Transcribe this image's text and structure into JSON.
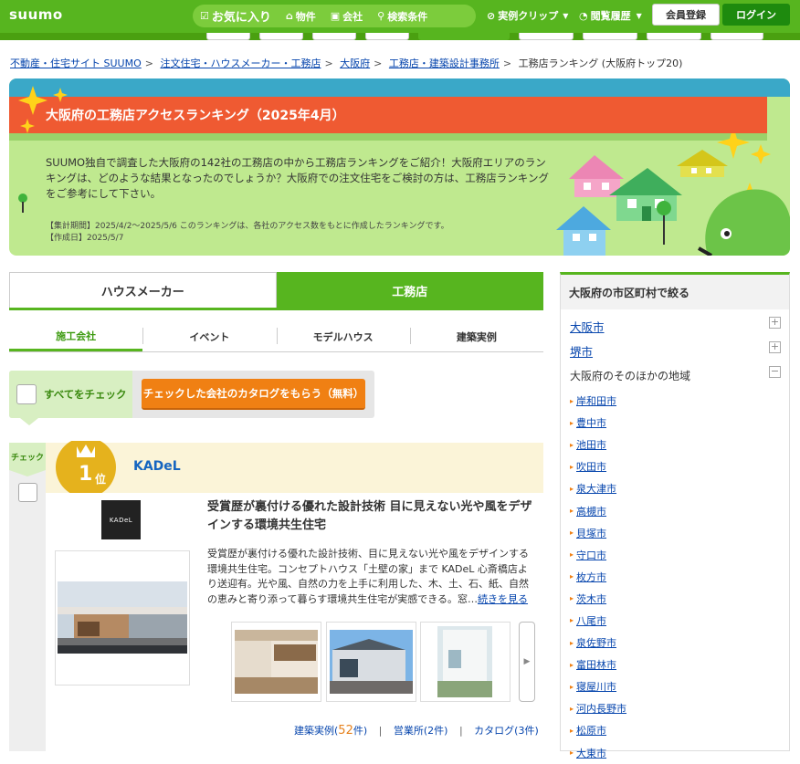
{
  "header": {
    "logo": "suumo",
    "nav": {
      "favorites": "お気に入り",
      "property": "物件",
      "company": "会社",
      "search": "検索条件"
    },
    "clip": "実例クリップ",
    "history": "閲覧履歴",
    "member": "会員登録",
    "login": "ログイン"
  },
  "breadcrumb": {
    "items": [
      "不動産・住宅サイト SUUMO",
      "注文住宅・ハウスメーカー・工務店",
      "大阪府",
      "工務店・建築設計事務所"
    ],
    "current": "工務店ランキング (大阪府トップ20)"
  },
  "hero": {
    "title": "大阪府の工務店アクセスランキング（2025年4月）",
    "description": "SUUMO独自で調査した大阪府の142社の工務店の中から工務店ランキングをご紹介！大阪府エリアのランキングは、どのような結果となったのでしょうか？大阪府での注文住宅をご検討の方は、工務店ランキングをご参考にして下さい。",
    "period": "【集計期間】2025/4/2～2025/5/6 このランキングは、各社のアクセス数をもとに作成したランキングです。",
    "created": "【作成日】2025/5/7"
  },
  "tabs": {
    "main": [
      "ハウスメーカー",
      "工務店"
    ],
    "sub": [
      "施工会社",
      "イベント",
      "モデルハウス",
      "建築実例"
    ]
  },
  "checkbar": {
    "check_all": "すべてをチェック",
    "catalog_button": "チェックした会社のカタログをもらう（無料）"
  },
  "ranking": {
    "check_label": "チェック",
    "rank_number": "1",
    "rank_suffix": "位",
    "company": "KADeL",
    "logo_text": "KADeL",
    "heading": "受賞歴が裏付ける優れた設計技術 目に見えない光や風をデザインする環境共生住宅",
    "description": "受賞歴が裏付ける優れた設計技術、目に見えない光や風をデザインする環境共生住宅。コンセプトハウス「土壁の家」まで KADeL 心斎橋店より送迎有。光や風、自然の力を上手に利用した、木、土、石、紙、自然の恵みと寄り添って暮らす環境共生住宅が実感できる。窓…",
    "read_more": "続きを見る",
    "links": {
      "examples_label": "建築実例(",
      "examples_count": "52",
      "examples_unit": "件)",
      "offices": "営業所(2件)",
      "catalog": "カタログ(3件)"
    }
  },
  "sidebar": {
    "title": "大阪府の市区町村で絞る",
    "top": [
      "大阪市",
      "堺市"
    ],
    "other": "大阪府のそのほかの地域",
    "cities": [
      "岸和田市",
      "豊中市",
      "池田市",
      "吹田市",
      "泉大津市",
      "高槻市",
      "貝塚市",
      "守口市",
      "枚方市",
      "茨木市",
      "八尾市",
      "泉佐野市",
      "富田林市",
      "寝屋川市",
      "河内長野市",
      "松原市",
      "大東市"
    ]
  },
  "colors": {
    "brand_green": "#57b51f",
    "banner_red": "#ef5a32",
    "cta_orange": "#f08013",
    "link_blue": "#0645ad"
  }
}
